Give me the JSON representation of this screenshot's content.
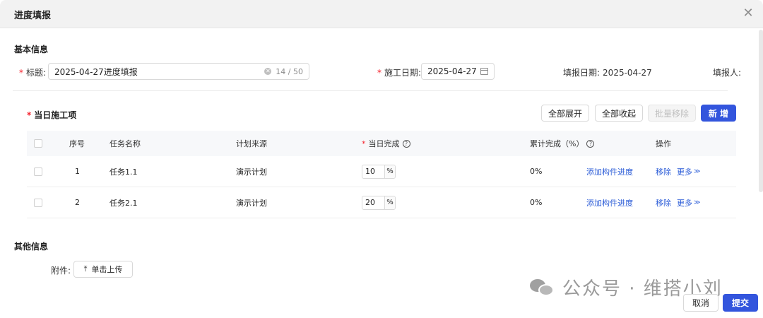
{
  "modal": {
    "title": "进度填报"
  },
  "basic_info": {
    "section_title": "基本信息",
    "title_label": "标题:",
    "title_value": "2025-04-27进度填报",
    "title_counter": "14 / 50",
    "construction_date_label": "施工日期:",
    "construction_date_value": "2025-04-27",
    "report_date_label": "填报日期:",
    "report_date_value": "2025-04-27",
    "reporter_label": "填报人:"
  },
  "daily_items": {
    "section_title": "当日施工项",
    "buttons": {
      "expand_all": "全部展开",
      "collapse_all": "全部收起",
      "batch_remove": "批量移除",
      "add": "新 增"
    },
    "columns": {
      "index": "序号",
      "task_name": "任务名称",
      "plan_source": "计划来源",
      "daily_complete": "当日完成",
      "cumulative": "累计完成（%）",
      "actions": "操作"
    },
    "rows": [
      {
        "index": "1",
        "task_name": "任务1.1",
        "plan_source": "演示计划",
        "daily_value": "10",
        "unit": "%",
        "cumulative": "0%",
        "add_component": "添加构件进度",
        "remove": "移除",
        "more": "更多"
      },
      {
        "index": "2",
        "task_name": "任务2.1",
        "plan_source": "演示计划",
        "daily_value": "20",
        "unit": "%",
        "cumulative": "0%",
        "add_component": "添加构件进度",
        "remove": "移除",
        "more": "更多"
      }
    ]
  },
  "other_info": {
    "section_title": "其他信息",
    "attachment_label": "附件:",
    "upload_label": "单击上传"
  },
  "watermark": {
    "text": "公众号 · 维搭小刘"
  },
  "footer": {
    "cancel": "取消",
    "submit": "提交"
  }
}
